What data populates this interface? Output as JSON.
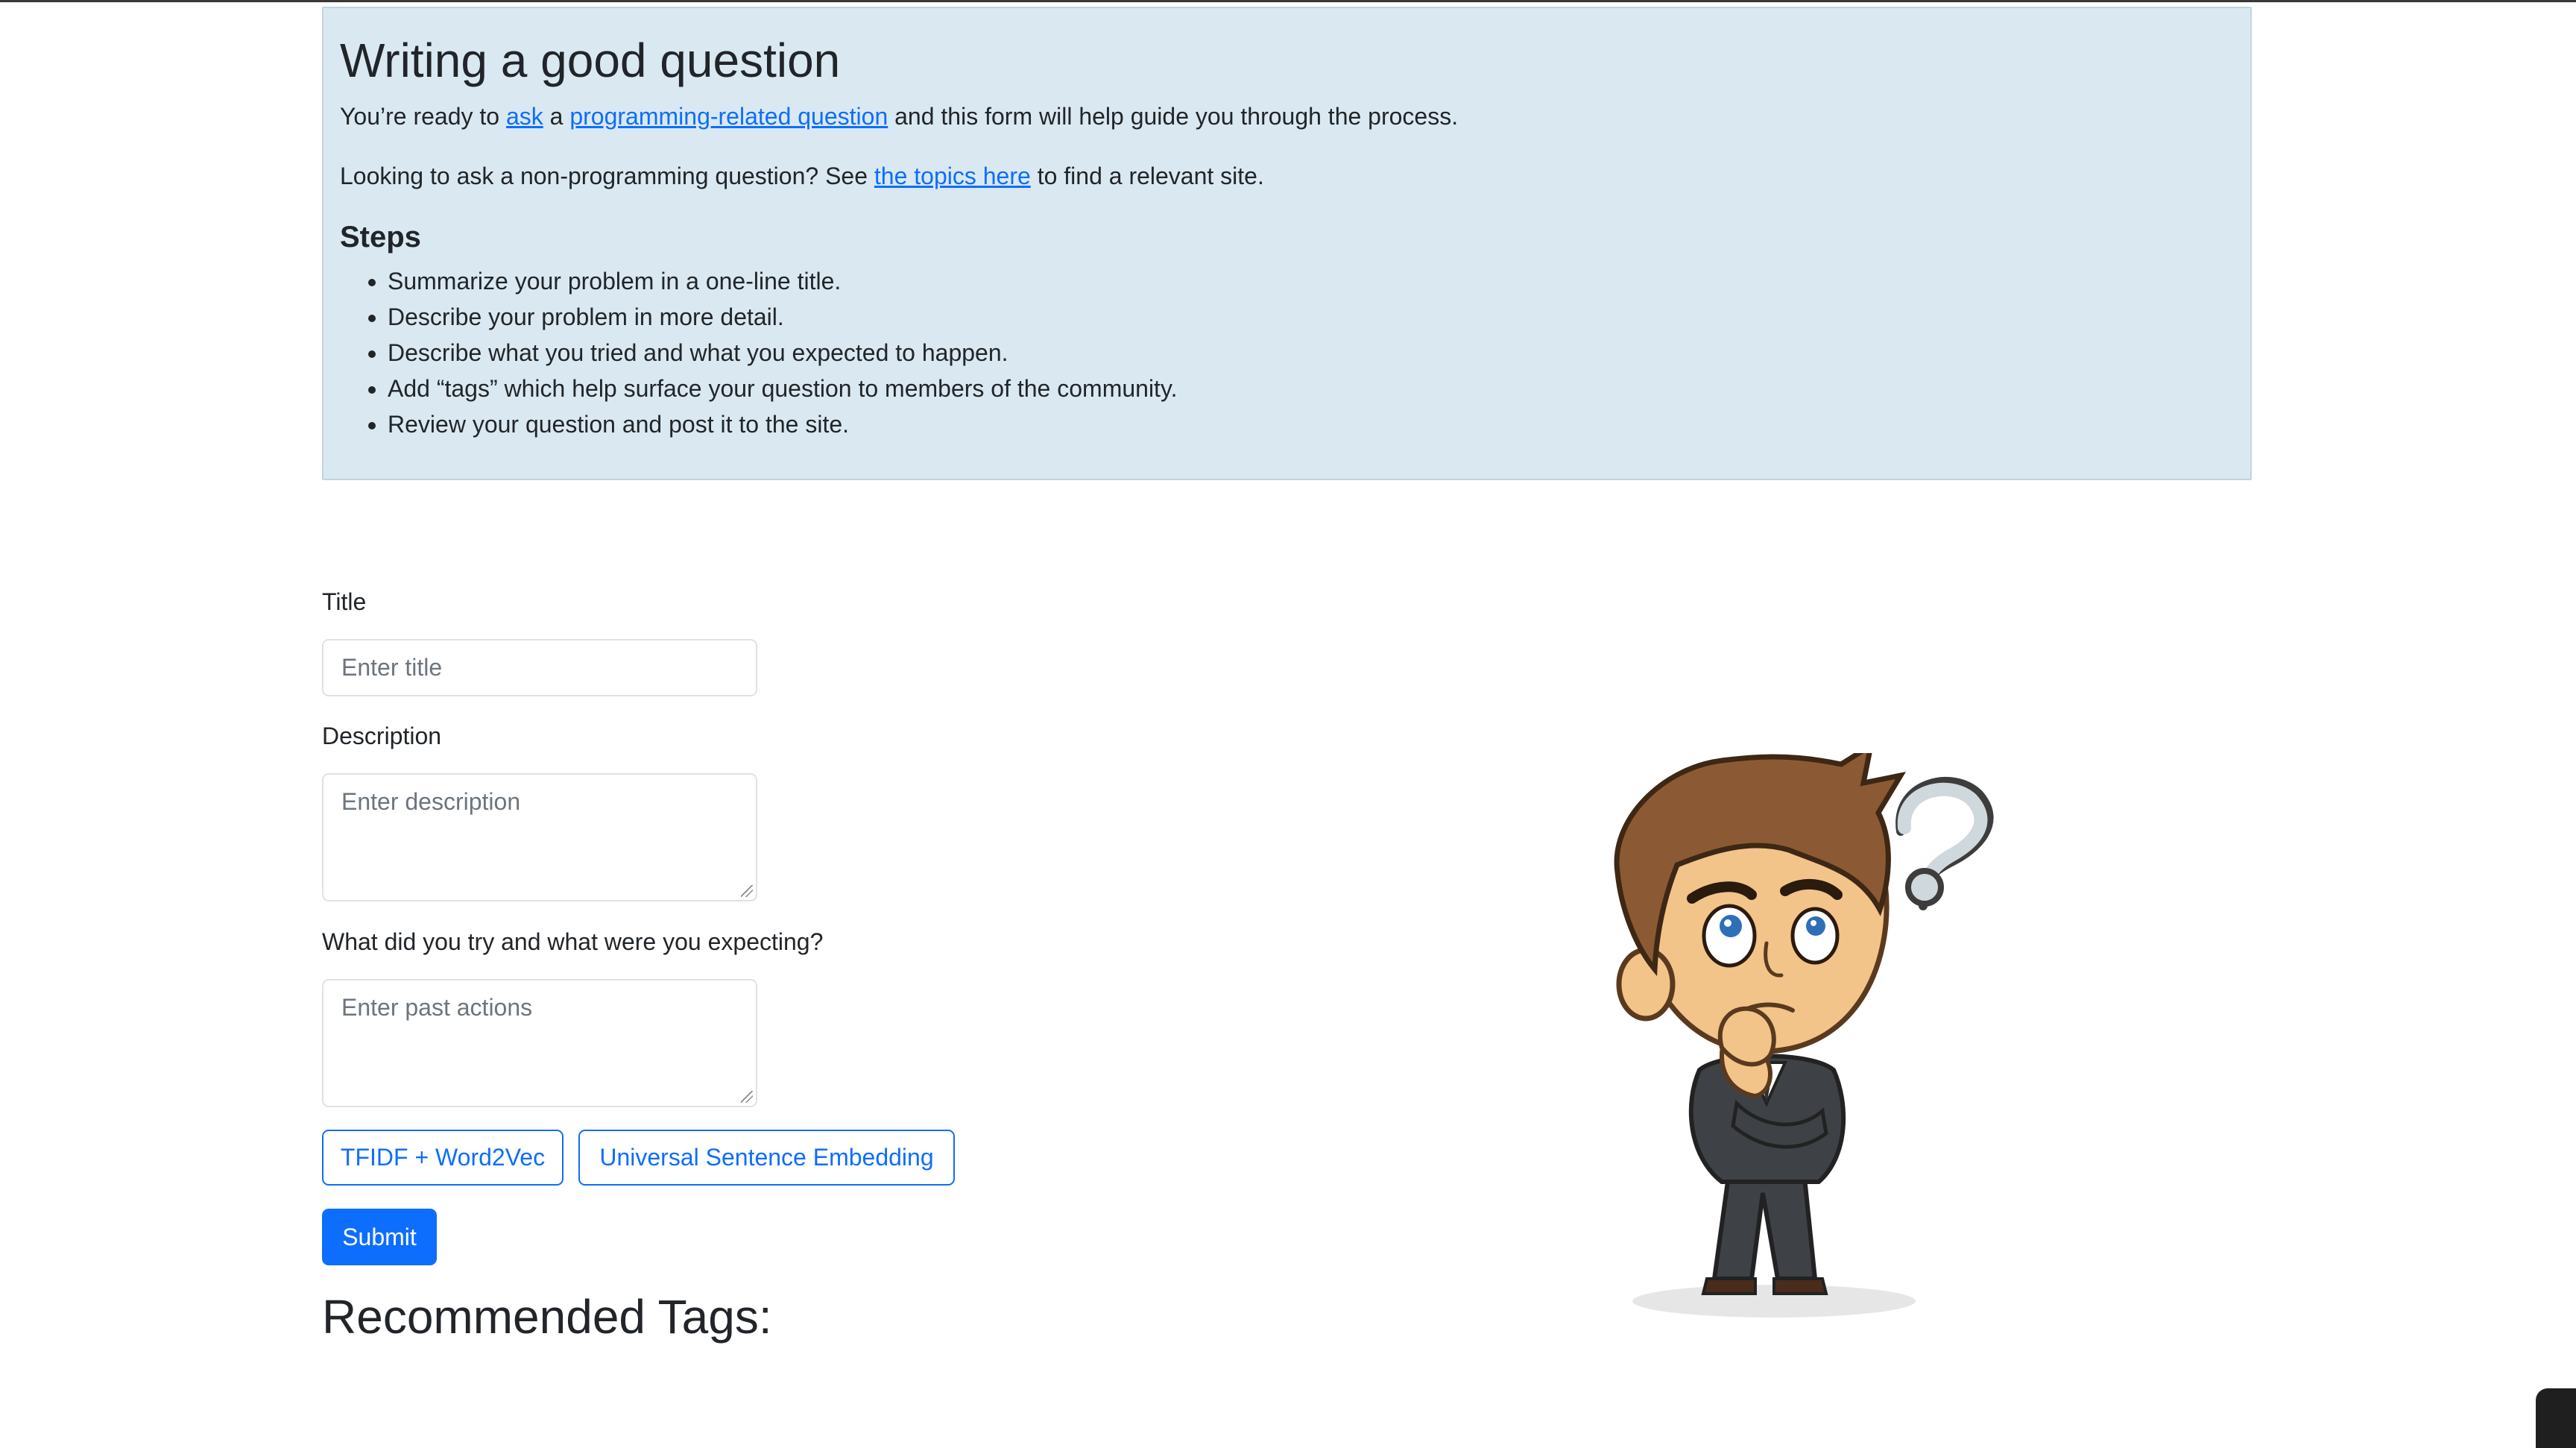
{
  "guide": {
    "title": "Writing a good question",
    "intro": {
      "before_ask": "You’re ready to ",
      "ask_link": "ask",
      "between": " a ",
      "prq_link": "programming-related question",
      "after": " and this form will help guide you through the process."
    },
    "nonprog": {
      "before": "Looking to ask a non-programming question? See ",
      "topics_link": "the topics here",
      "after": " to find a relevant site."
    },
    "steps_heading": "Steps",
    "steps": [
      "Summarize your problem in a one-line title.",
      "Describe your problem in more detail.",
      "Describe what you tried and what you expected to happen.",
      "Add “tags” which help surface your question to members of the community.",
      "Review your question and post it to the site."
    ]
  },
  "form": {
    "title_label": "Title",
    "title_placeholder": "Enter title",
    "description_label": "Description",
    "description_placeholder": "Enter description",
    "tried_label": "What did you try and what were you expecting?",
    "tried_placeholder": "Enter past actions",
    "model_buttons": [
      "TFIDF + Word2Vec",
      "Universal Sentence Embedding"
    ],
    "submit_label": "Submit"
  },
  "results": {
    "heading": "Recommended Tags:"
  },
  "colors": {
    "panel_bg": "#dae9f1",
    "primary": "#0d6efd",
    "text": "#212529"
  },
  "icons": {
    "illustration": "thinking-man-question-mark-illustration"
  }
}
